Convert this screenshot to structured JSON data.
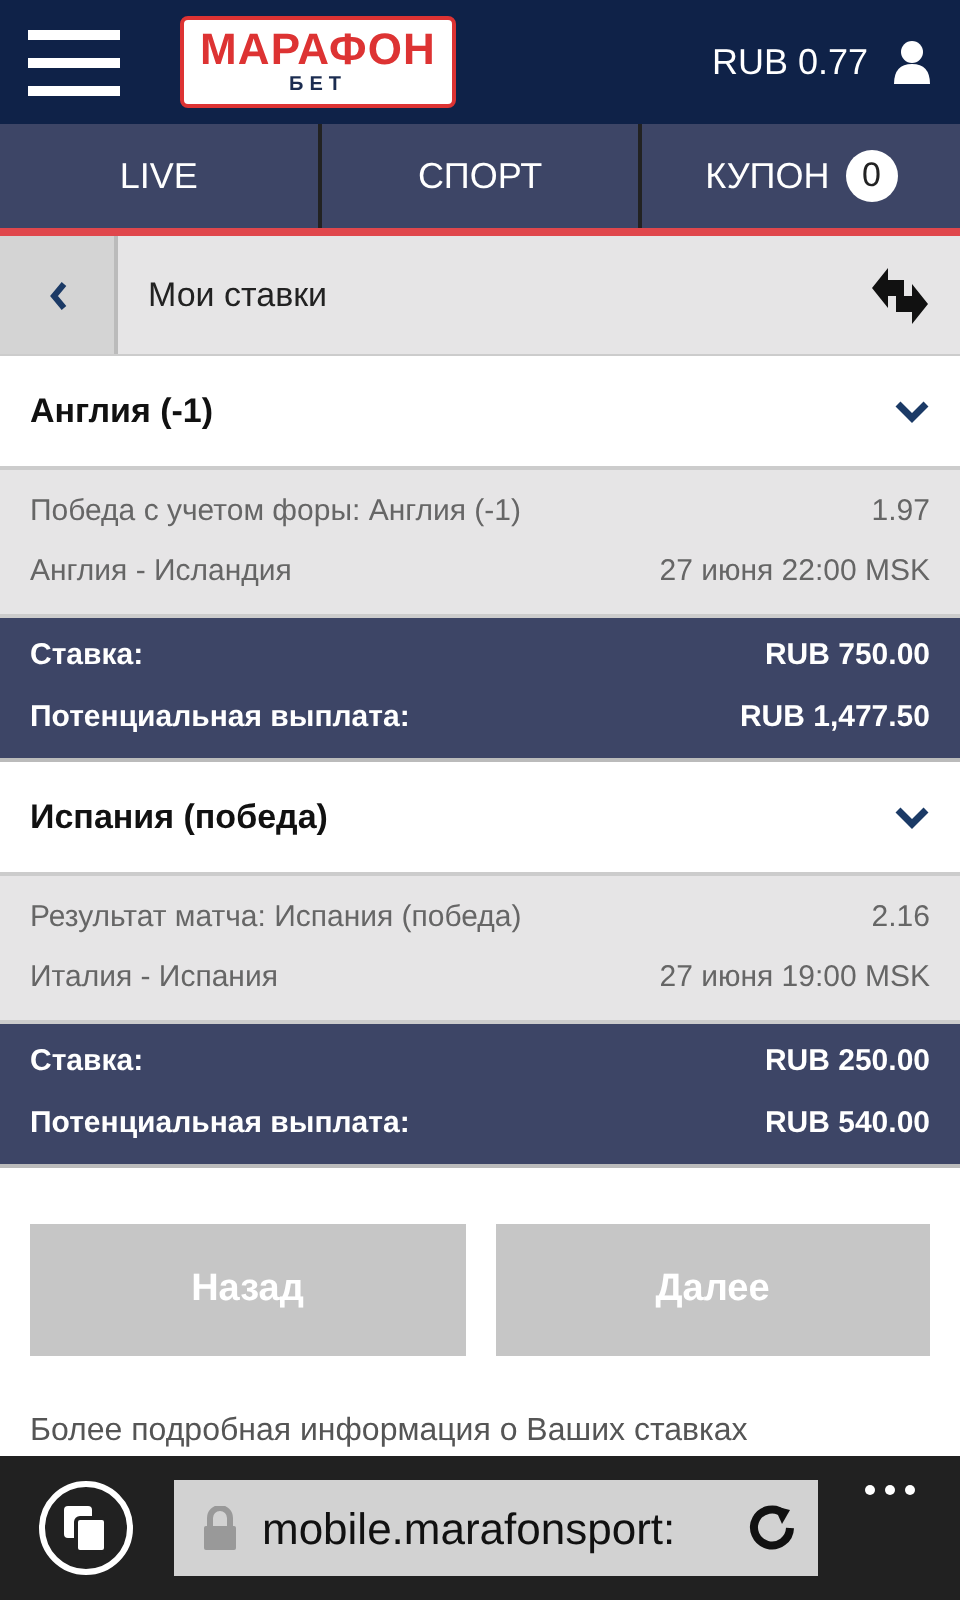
{
  "header": {
    "logo_main": "МАРАФОН",
    "logo_sub": "БЕТ",
    "balance": "RUB 0.77"
  },
  "tabs": [
    {
      "label": "LIVE",
      "selected": false
    },
    {
      "label": "СПОРТ",
      "selected": false
    },
    {
      "label": "КУПОН",
      "selected": false,
      "badge": "0"
    }
  ],
  "subheader": {
    "title": "Мои ставки"
  },
  "bets": [
    {
      "title": "Англия (-1)",
      "market": "Победа с учетом форы: Англия (-1)",
      "odds": "1.97",
      "match": "Англия - Исландия",
      "time": "27 июня 22:00 MSK",
      "stake_label": "Ставка:",
      "stake": "RUB 750.00",
      "payout_label": "Потенциальная выплата:",
      "payout": "RUB 1,477.50"
    },
    {
      "title": "Испания (победа)",
      "market": "Результат матча: Испания (победа)",
      "odds": "2.16",
      "match": "Италия - Испания",
      "time": "27 июня 19:00 MSK",
      "stake_label": "Ставка:",
      "stake": "RUB 250.00",
      "payout_label": "Потенциальная выплата:",
      "payout": "RUB 540.00"
    }
  ],
  "buttons": [
    {
      "label": "Назад",
      "disabled": true
    },
    {
      "label": "Далее",
      "disabled": true
    }
  ],
  "info_text": "Более подробная информация о Ваших ставках",
  "browser": {
    "url": "mobile.marafonsport:"
  }
}
